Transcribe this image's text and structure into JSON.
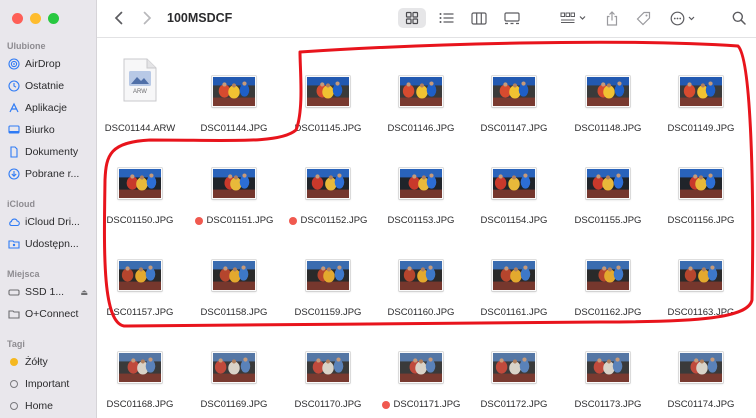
{
  "window": {
    "title": "100MSDCF"
  },
  "sidebar": {
    "sections": [
      {
        "label": "Ulubione",
        "items": [
          {
            "label": "AirDrop",
            "icon": "airdrop-icon"
          },
          {
            "label": "Ostatnie",
            "icon": "clock-icon"
          },
          {
            "label": "Aplikacje",
            "icon": "apps-icon"
          },
          {
            "label": "Biurko",
            "icon": "desktop-icon"
          },
          {
            "label": "Dokumenty",
            "icon": "document-icon"
          },
          {
            "label": "Pobrane r...",
            "icon": "download-icon"
          }
        ]
      },
      {
        "label": "iCloud",
        "items": [
          {
            "label": "iCloud Dri...",
            "icon": "cloud-icon"
          },
          {
            "label": "Udostępn...",
            "icon": "shared-folder-icon"
          }
        ]
      },
      {
        "label": "Miejsca",
        "items": [
          {
            "label": "SSD 1...",
            "icon": "drive-icon"
          },
          {
            "label": "O+Connect",
            "icon": "folder-icon"
          }
        ]
      },
      {
        "label": "Tagi",
        "items": [
          {
            "label": "Żółty",
            "icon": "tag-yellow-icon",
            "color": "#f5b820"
          },
          {
            "label": "Important",
            "icon": "tag-gray-icon"
          },
          {
            "label": "Home",
            "icon": "tag-gray-icon"
          }
        ]
      }
    ]
  },
  "files": [
    {
      "name": "DSC01144.ARW",
      "type": "raw"
    },
    {
      "name": "DSC01144.JPG",
      "type": "photo",
      "tag": false
    },
    {
      "name": "DSC01145.JPG",
      "type": "photo",
      "tag": false
    },
    {
      "name": "DSC01146.JPG",
      "type": "photo",
      "tag": false
    },
    {
      "name": "DSC01147.JPG",
      "type": "photo",
      "tag": false
    },
    {
      "name": "DSC01148.JPG",
      "type": "photo",
      "tag": false
    },
    {
      "name": "DSC01149.JPG",
      "type": "photo",
      "tag": false
    },
    {
      "name": "DSC01150.JPG",
      "type": "photo",
      "tag": false
    },
    {
      "name": "DSC01151.JPG",
      "type": "photo",
      "tag": true
    },
    {
      "name": "DSC01152.JPG",
      "type": "photo",
      "tag": true
    },
    {
      "name": "DSC01153.JPG",
      "type": "photo",
      "tag": false
    },
    {
      "name": "DSC01154.JPG",
      "type": "photo",
      "tag": false
    },
    {
      "name": "DSC01155.JPG",
      "type": "photo",
      "tag": false
    },
    {
      "name": "DSC01156.JPG",
      "type": "photo",
      "tag": false
    },
    {
      "name": "DSC01157.JPG",
      "type": "photo",
      "tag": false
    },
    {
      "name": "DSC01158.JPG",
      "type": "photo",
      "tag": false
    },
    {
      "name": "DSC01159.JPG",
      "type": "photo",
      "tag": false
    },
    {
      "name": "DSC01160.JPG",
      "type": "photo",
      "tag": false
    },
    {
      "name": "DSC01161.JPG",
      "type": "photo",
      "tag": false
    },
    {
      "name": "DSC01162.JPG",
      "type": "photo",
      "tag": false
    },
    {
      "name": "DSC01163.JPG",
      "type": "photo",
      "tag": false
    },
    {
      "name": "DSC01168.JPG",
      "type": "photo",
      "tag": false
    },
    {
      "name": "DSC01169.JPG",
      "type": "photo",
      "tag": false
    },
    {
      "name": "DSC01170.JPG",
      "type": "photo",
      "tag": false
    },
    {
      "name": "DSC01171.JPG",
      "type": "photo",
      "tag": true
    },
    {
      "name": "DSC01172.JPG",
      "type": "photo",
      "tag": false
    },
    {
      "name": "DSC01173.JPG",
      "type": "photo",
      "tag": false
    },
    {
      "name": "DSC01174.JPG",
      "type": "photo",
      "tag": false
    }
  ],
  "raw_badge": "ARW",
  "colors": {
    "tag_red": "#f0594f",
    "annotation": "#e8141c",
    "sidebar_icon": "#2f7bf5"
  },
  "toolbar": {
    "icons": [
      "back-icon",
      "forward-icon",
      "grid-view-icon",
      "list-view-icon",
      "column-view-icon",
      "gallery-view-icon",
      "group-icon",
      "share-icon",
      "tag-icon",
      "more-icon",
      "search-icon"
    ]
  }
}
